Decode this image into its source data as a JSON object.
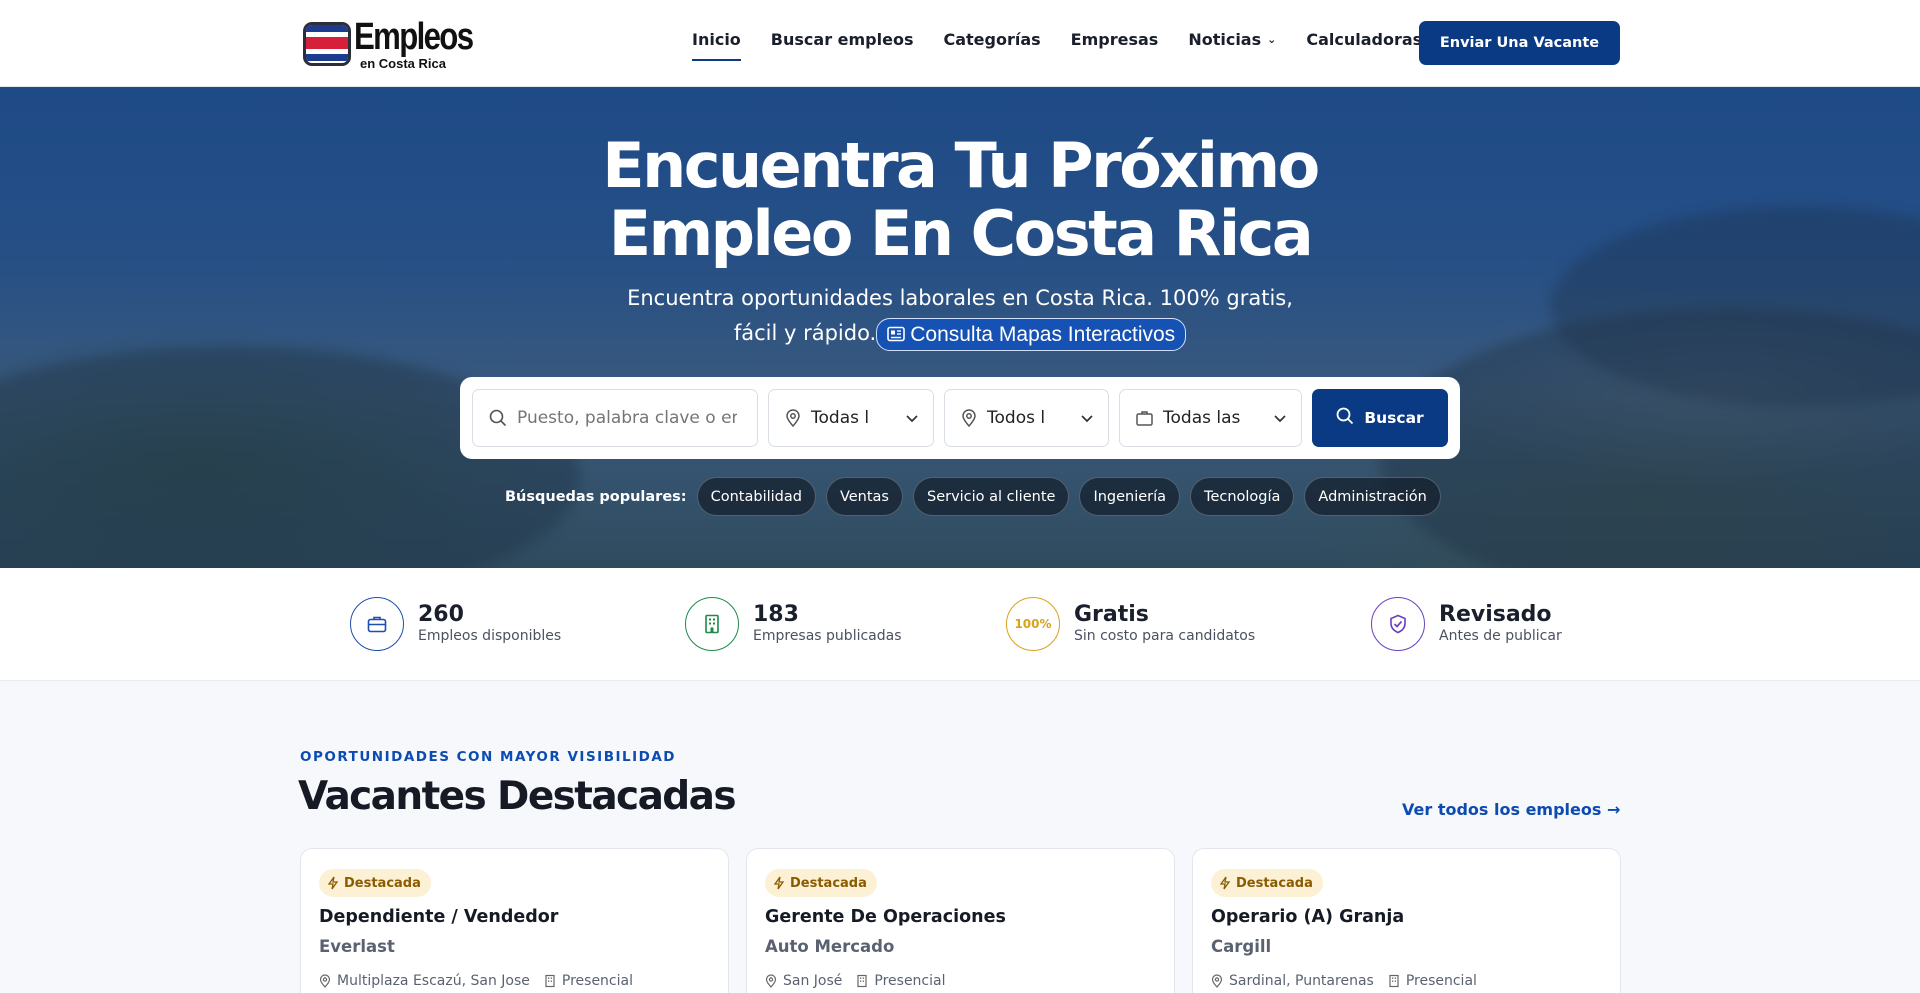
{
  "brand": {
    "name": "Empleos",
    "subtitle": "en Costa Rica"
  },
  "nav": {
    "items": [
      {
        "label": "Inicio",
        "active": true
      },
      {
        "label": "Buscar empleos"
      },
      {
        "label": "Categorías"
      },
      {
        "label": "Empresas"
      },
      {
        "label": "Noticias",
        "has_dropdown": true
      },
      {
        "label": "Calculadoras"
      }
    ],
    "cta_label": "Enviar Una Vacante"
  },
  "hero": {
    "title_line1": "Encuentra Tu Próximo",
    "title_line2": "Empleo En Costa Rica",
    "subtitle_line1": "Encuentra oportunidades laborales en Costa Rica. 100% gratis,",
    "subtitle_line2": "fácil y rápido.",
    "map_link_label": "Consulta Mapas Interactivos"
  },
  "search": {
    "keyword_placeholder": "Puesto, palabra clave o empresa",
    "province_value": "Todas l",
    "canton_value": "Todos l",
    "category_value": "Todas las",
    "button_label": "Buscar"
  },
  "popular": {
    "label": "Búsquedas populares:",
    "tags": [
      "Contabilidad",
      "Ventas",
      "Servicio al cliente",
      "Ingeniería",
      "Tecnología",
      "Administración"
    ]
  },
  "stats": [
    {
      "value": "260",
      "label": "Empleos disponibles",
      "icon": "briefcase-icon",
      "color": "#1d4fae"
    },
    {
      "value": "183",
      "label": "Empresas publicadas",
      "icon": "building-icon",
      "color": "#1e8a4a"
    },
    {
      "value": "Gratis",
      "label": "Sin costo para candidatos",
      "icon": "percent-badge-icon",
      "badge_text": "100%",
      "color": "#d9a21b"
    },
    {
      "value": "Revisado",
      "label": "Antes de publicar",
      "icon": "shield-check-icon",
      "color": "#6b3fc4"
    }
  ],
  "featured": {
    "eyebrow": "OPORTUNIDADES CON MAYOR VISIBILIDAD",
    "title": "Vacantes Destacadas",
    "view_all_label": "Ver todos los empleos →",
    "cards": [
      {
        "badge": "Destacada",
        "title": "Dependiente / Vendedor",
        "company": "Everlast",
        "location": "Multiplaza Escazú, San Jose",
        "modality": "Presencial"
      },
      {
        "badge": "Destacada",
        "title": "Gerente De Operaciones",
        "company": "Auto Mercado",
        "location": "San José",
        "modality": "Presencial"
      },
      {
        "badge": "Destacada",
        "title": "Operario (A) Granja",
        "company": "Cargill",
        "location": "Sardinal, Puntarenas",
        "modality": "Presencial"
      }
    ]
  },
  "colors": {
    "primary": "#0b3a85",
    "accent_link": "#0c4bb0",
    "badge_bg": "#fdf1d5",
    "badge_text": "#8a5b00"
  }
}
